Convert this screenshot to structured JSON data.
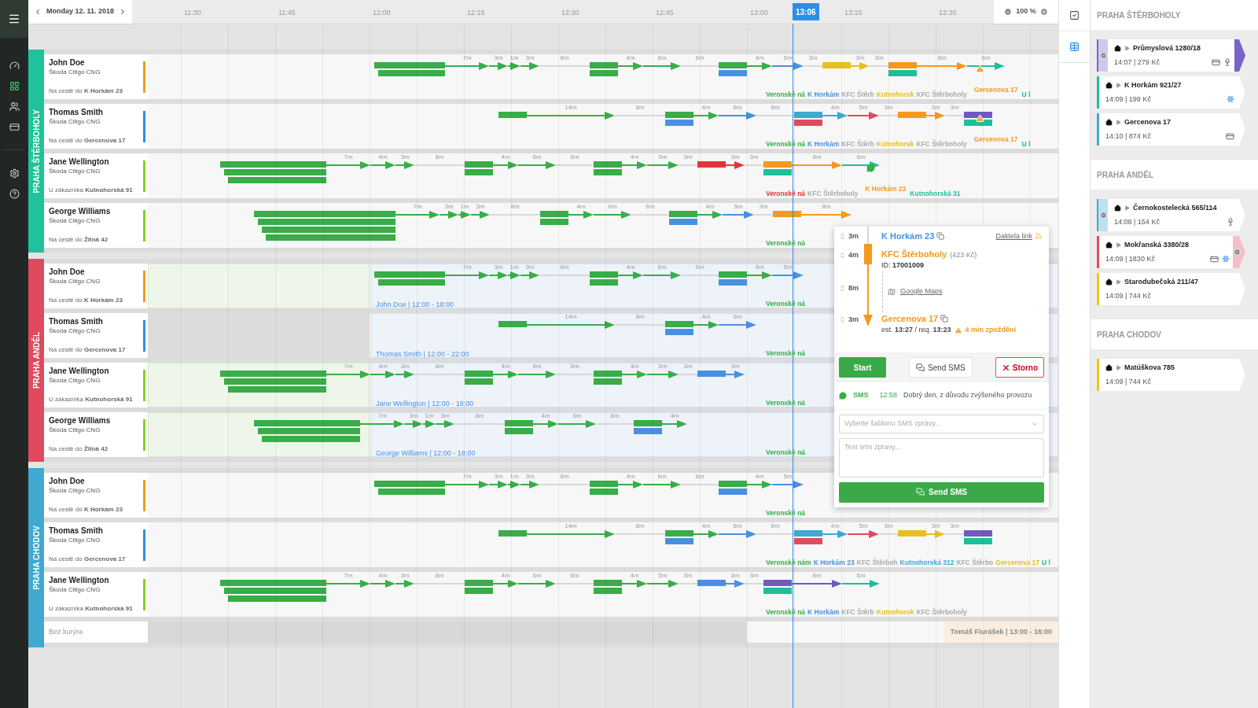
{
  "nav": {
    "items": [
      {
        "kind": "dashboard",
        "selected": false
      },
      {
        "kind": "planner",
        "selected": true
      },
      {
        "kind": "couriers",
        "selected": false
      },
      {
        "kind": "payments",
        "selected": false
      },
      {
        "kind": "settings",
        "selected": false
      },
      {
        "kind": "help",
        "selected": false
      }
    ]
  },
  "date_nav": {
    "label": "Monday 12. 11. 2018"
  },
  "timeline": {
    "ticks": [
      "11:30",
      "11:45",
      "12:00",
      "12:15",
      "12:30",
      "12:45",
      "13:00",
      "13:15",
      "13:30"
    ],
    "now": "13:06"
  },
  "zoom": {
    "label": "100 %"
  },
  "groups": [
    {
      "name": "PRAHA ŠTĚRBOHOLY",
      "color": "#1fc29a",
      "couriers": [
        {
          "name": "John Doe",
          "vehicle": "Škoda Citigo CNG",
          "status": "Na cestě do **K Horkám 23**",
          "color": "#f39a1e",
          "track": [
            {
              "kind": "long",
              "parts": [
                {
                  "color": "#38ad48"
                },
                {
                  "color": "#38ad48"
                }
              ]
            },
            {
              "kind": "drive",
              "label": "7m",
              "color": "#38ad48"
            },
            {
              "kind": "drive",
              "label": "3m",
              "color": "#38ad48"
            },
            {
              "kind": "drive",
              "label": "1m",
              "color": "#38ad48"
            },
            {
              "kind": "drive",
              "label": "3m",
              "color": "#38ad48"
            },
            {
              "kind": "wait",
              "label": "8m"
            },
            {
              "kind": "block",
              "parts": [
                {
                  "color": "#38ad48"
                },
                {
                  "color": "#38ad48"
                }
              ]
            },
            {
              "kind": "drive",
              "label": "4m",
              "color": "#38ad48"
            },
            {
              "kind": "drive",
              "label": "6m",
              "color": "#38ad48"
            },
            {
              "kind": "wait",
              "label": "6m"
            },
            {
              "kind": "block",
              "parts": [
                {
                  "color": "#38ad48"
                },
                {
                  "color": "#4a90e2"
                }
              ]
            },
            {
              "kind": "drive",
              "label": "4m",
              "color": "#38ad48"
            },
            {
              "kind": "drive",
              "label": "5m",
              "color": "#4a90e2"
            },
            {
              "kind": "wait",
              "label": "3m"
            },
            {
              "kind": "block",
              "parts": [
                {
                  "color": "#e8c01e"
                }
              ]
            },
            {
              "kind": "drive",
              "label": "3m",
              "color": "#e8c01e"
            },
            {
              "kind": "wait",
              "label": "3m"
            },
            {
              "kind": "block",
              "parts": [
                {
                  "color": "#f39a1e"
                },
                {
                  "color": "#1dbf97"
                }
              ]
            },
            {
              "kind": "drive",
              "label": "8m",
              "color": "#f39a1e"
            },
            {
              "kind": "drive",
              "label": "6m",
              "color": "#1dbf97"
            }
          ],
          "stops": [
            {
              "kind": "stop",
              "text": "Veronské ná",
              "color": "#38ad48"
            },
            {
              "kind": "stop",
              "text": "K Horkám",
              "color": "#4a90e2"
            },
            {
              "kind": "stop",
              "text": "KFC Štěrb",
              "color": "#aaaaaa"
            },
            {
              "kind": "stop",
              "text": "Kutnohorsk",
              "color": "#e8c01e"
            },
            {
              "kind": "stop",
              "text": "KFC Štěrboholy",
              "color": "#aaaaaa"
            },
            {
              "kind": "alert",
              "text": "Gercenova 17",
              "color": "#f39a1e"
            },
            {
              "kind": "stop",
              "text": "U l",
              "color": "#1dbf97"
            }
          ]
        },
        {
          "name": "Thomas Smith",
          "vehicle": "Škoda Citigo CNG",
          "status": "Na cestě do **Gercenova 17**",
          "color": "#2d8ee6",
          "track": [
            {
              "kind": "block",
              "parts": [
                {
                  "color": "#38ad48"
                }
              ]
            },
            {
              "kind": "drive",
              "label": "14m",
              "color": "#38ad48"
            },
            {
              "kind": "wait",
              "label": "8m"
            },
            {
              "kind": "block",
              "parts": [
                {
                  "color": "#38ad48"
                },
                {
                  "color": "#4a90e2"
                }
              ]
            },
            {
              "kind": "drive",
              "label": "4m",
              "color": "#38ad48"
            },
            {
              "kind": "drive",
              "label": "6m",
              "color": "#4a90e2"
            },
            {
              "kind": "wait",
              "label": "6m"
            },
            {
              "kind": "block",
              "parts": [
                {
                  "color": "#3fa9d0"
                },
                {
                  "color": "#e04a5f"
                }
              ]
            },
            {
              "kind": "drive",
              "label": "4m",
              "color": "#3fa9d0"
            },
            {
              "kind": "drive",
              "label": "5m",
              "color": "#e04a5f"
            },
            {
              "kind": "wait",
              "label": "3m"
            },
            {
              "kind": "block",
              "parts": [
                {
                  "color": "#f39a1e"
                }
              ]
            },
            {
              "kind": "drive",
              "label": "3m",
              "color": "#f39a1e"
            },
            {
              "kind": "wait",
              "label": "3m"
            },
            {
              "kind": "block",
              "parts": [
                {
                  "color": "#6e5bc0"
                },
                {
                  "color": "#1dbf97"
                }
              ]
            }
          ],
          "stops": [
            {
              "kind": "stop",
              "text": "Veronské ná",
              "color": "#38ad48"
            },
            {
              "kind": "stop",
              "text": "K Horkám",
              "color": "#4a90e2"
            },
            {
              "kind": "stop",
              "text": "KFC Štěrb",
              "color": "#aaaaaa"
            },
            {
              "kind": "stop",
              "text": "Kutnohorsk",
              "color": "#e8c01e"
            },
            {
              "kind": "stop",
              "text": "KFC Štěrboholy",
              "color": "#aaaaaa"
            },
            {
              "kind": "alert",
              "text": "Gercenova 17",
              "color": "#f39a1e"
            },
            {
              "kind": "stop",
              "text": "U l",
              "color": "#1dbf97"
            }
          ]
        },
        {
          "name": "Jane Wellington",
          "vehicle": "Škoda Citigo CNG",
          "status": "U zákazníka **Kutnohorská 91**",
          "color": "#7ed321",
          "track": [
            {
              "kind": "long",
              "parts": [
                {
                  "color": "#38ad48"
                },
                {
                  "color": "#38ad48"
                },
                {
                  "color": "#38ad48"
                }
              ]
            },
            {
              "kind": "drive",
              "label": "7m",
              "color": "#38ad48"
            },
            {
              "kind": "drive",
              "label": "4m",
              "color": "#38ad48"
            },
            {
              "kind": "drive",
              "label": "3m",
              "color": "#38ad48"
            },
            {
              "kind": "wait",
              "label": "8m"
            },
            {
              "kind": "block",
              "parts": [
                {
                  "color": "#38ad48"
                },
                {
                  "color": "#38ad48"
                }
              ]
            },
            {
              "kind": "drive",
              "label": "4m",
              "color": "#38ad48"
            },
            {
              "kind": "drive",
              "label": "6m",
              "color": "#38ad48"
            },
            {
              "kind": "wait",
              "label": "6m"
            },
            {
              "kind": "block",
              "parts": [
                {
                  "color": "#38ad48"
                },
                {
                  "color": "#38ad48"
                }
              ]
            },
            {
              "kind": "drive",
              "label": "4m",
              "color": "#38ad48"
            },
            {
              "kind": "drive",
              "label": "5m",
              "color": "#38ad48"
            },
            {
              "kind": "wait",
              "label": "3m"
            },
            {
              "kind": "block",
              "parts": [
                {
                  "color": "#e5333b"
                }
              ]
            },
            {
              "kind": "drive",
              "label": "3m",
              "color": "#e5333b"
            },
            {
              "kind": "wait",
              "label": "3m"
            },
            {
              "kind": "block",
              "parts": [
                {
                  "color": "#f39a1e"
                },
                {
                  "color": "#1dbf97"
                }
              ]
            },
            {
              "kind": "drive",
              "label": "8m",
              "color": "#f39a1e"
            },
            {
              "kind": "drive",
              "label": "6m",
              "color": "#1dbf97"
            }
          ],
          "stops": [
            {
              "kind": "stop",
              "text": "Veronské ná",
              "color": "#e5333b"
            },
            {
              "kind": "stop",
              "text": "KFC Štěrboholy",
              "color": "#aaaaaa"
            },
            {
              "kind": "chat",
              "text": "K Horkám 23",
              "color": "#f39a1e"
            },
            {
              "kind": "stop",
              "text": "Kutnohorská 31",
              "color": "#1dbf97"
            }
          ]
        },
        {
          "name": "George Williams",
          "vehicle": "Škoda Citigo CNG",
          "status": "Na cestě do **Žitná 42**",
          "color": "#7ed321",
          "track": [
            {
              "kind": "long",
              "parts": [
                {
                  "color": "#38ad48"
                },
                {
                  "color": "#38ad48"
                },
                {
                  "color": "#38ad48"
                },
                {
                  "color": "#38ad48"
                }
              ]
            },
            {
              "kind": "drive",
              "label": "7m",
              "color": "#38ad48"
            },
            {
              "kind": "drive",
              "label": "3m",
              "color": "#38ad48"
            },
            {
              "kind": "drive",
              "label": "1m",
              "color": "#38ad48"
            },
            {
              "kind": "drive",
              "label": "3m",
              "color": "#38ad48"
            },
            {
              "kind": "wait",
              "label": "8m"
            },
            {
              "kind": "block",
              "parts": [
                {
                  "color": "#38ad48"
                },
                {
                  "color": "#38ad48"
                }
              ]
            },
            {
              "kind": "drive",
              "label": "4m",
              "color": "#38ad48"
            },
            {
              "kind": "drive",
              "label": "6m",
              "color": "#38ad48"
            },
            {
              "kind": "wait",
              "label": "6m"
            },
            {
              "kind": "block",
              "parts": [
                {
                  "color": "#38ad48"
                },
                {
                  "color": "#4a90e2"
                }
              ]
            },
            {
              "kind": "drive",
              "label": "4m",
              "color": "#38ad48"
            },
            {
              "kind": "drive",
              "label": "5m",
              "color": "#4a90e2"
            },
            {
              "kind": "wait",
              "label": "3m"
            },
            {
              "kind": "block",
              "parts": [
                {
                  "color": "#f39a1e"
                }
              ]
            },
            {
              "kind": "drive",
              "label": "8m",
              "color": "#f39a1e"
            }
          ],
          "stops": [
            {
              "kind": "stop",
              "text": "Veronské ná",
              "color": "#38ad48"
            }
          ]
        }
      ]
    },
    {
      "name": "PRAHA ANDĚL",
      "color": "#e04a5f",
      "couriers": [
        {
          "name": "John Doe",
          "vehicle": "Škoda Citigo CNG",
          "status": "Na cestě do **K Horkám 23**",
          "color": "#f39a1e",
          "shift": {
            "label": "John Doe | 12:00 - 18:00",
            "free_before": true
          },
          "track": [
            {
              "kind": "long",
              "parts": [
                {
                  "color": "#38ad48"
                },
                {
                  "color": "#38ad48"
                }
              ]
            },
            {
              "kind": "drive",
              "label": "7m",
              "color": "#38ad48"
            },
            {
              "kind": "drive",
              "label": "3m",
              "color": "#38ad48"
            },
            {
              "kind": "drive",
              "label": "1m",
              "color": "#38ad48"
            },
            {
              "kind": "drive",
              "label": "3m",
              "color": "#38ad48"
            },
            {
              "kind": "wait",
              "label": "8m"
            },
            {
              "kind": "block",
              "parts": [
                {
                  "color": "#38ad48"
                },
                {
                  "color": "#38ad48"
                }
              ]
            },
            {
              "kind": "drive",
              "label": "4m",
              "color": "#38ad48"
            },
            {
              "kind": "drive",
              "label": "6m",
              "color": "#38ad48"
            },
            {
              "kind": "wait",
              "label": "6m"
            },
            {
              "kind": "block",
              "parts": [
                {
                  "color": "#38ad48"
                },
                {
                  "color": "#4a90e2"
                }
              ]
            },
            {
              "kind": "drive",
              "label": "4m",
              "color": "#38ad48"
            },
            {
              "kind": "drive",
              "label": "5m",
              "color": "#4a90e2"
            }
          ],
          "stops": [
            {
              "kind": "stop",
              "text": "Veronské ná",
              "color": "#38ad48"
            }
          ]
        },
        {
          "name": "Thomas Smith",
          "vehicle": "Škoda Citigo CNG",
          "status": "Na cestě do **Gercenova 17**",
          "color": "#2d8ee6",
          "shift": {
            "label": "Thomas Smith | 12:00 - 22:00",
            "free_before": false
          },
          "track": [
            {
              "kind": "block",
              "parts": [
                {
                  "color": "#38ad48"
                }
              ]
            },
            {
              "kind": "drive",
              "label": "14m",
              "color": "#38ad48"
            },
            {
              "kind": "wait",
              "label": "8m"
            },
            {
              "kind": "block",
              "parts": [
                {
                  "color": "#38ad48"
                },
                {
                  "color": "#4a90e2"
                }
              ]
            },
            {
              "kind": "drive",
              "label": "4m",
              "color": "#38ad48"
            },
            {
              "kind": "drive",
              "label": "6m",
              "color": "#4a90e2"
            }
          ],
          "stops": [
            {
              "kind": "stop",
              "text": "Veronské ná",
              "color": "#38ad48"
            }
          ]
        },
        {
          "name": "Jane Wellington",
          "vehicle": "Škoda Citigo CNG",
          "status": "U zákazníka **Kutnohorská 91**",
          "color": "#7ed321",
          "shift": {
            "label": "Jane Wellington | 12:00 - 18:00",
            "free_before": true
          },
          "track": [
            {
              "kind": "long",
              "parts": [
                {
                  "color": "#38ad48"
                },
                {
                  "color": "#38ad48"
                },
                {
                  "color": "#38ad48"
                }
              ]
            },
            {
              "kind": "drive",
              "label": "7m",
              "color": "#38ad48"
            },
            {
              "kind": "drive",
              "label": "4m",
              "color": "#38ad48"
            },
            {
              "kind": "drive",
              "label": "3m",
              "color": "#38ad48"
            },
            {
              "kind": "wait",
              "label": "8m"
            },
            {
              "kind": "block",
              "parts": [
                {
                  "color": "#38ad48"
                },
                {
                  "color": "#38ad48"
                }
              ]
            },
            {
              "kind": "drive",
              "label": "4m",
              "color": "#38ad48"
            },
            {
              "kind": "drive",
              "label": "6m",
              "color": "#38ad48"
            },
            {
              "kind": "wait",
              "label": "6m"
            },
            {
              "kind": "block",
              "parts": [
                {
                  "color": "#38ad48"
                },
                {
                  "color": "#38ad48"
                }
              ]
            },
            {
              "kind": "drive",
              "label": "4m",
              "color": "#38ad48"
            },
            {
              "kind": "drive",
              "label": "5m",
              "color": "#38ad48"
            },
            {
              "kind": "wait",
              "label": "3m"
            },
            {
              "kind": "block",
              "parts": [
                {
                  "color": "#4a90e2"
                }
              ]
            },
            {
              "kind": "drive",
              "label": "3m",
              "color": "#4a90e2"
            }
          ],
          "stops": [
            {
              "kind": "stop",
              "text": "Veronské ná",
              "color": "#38ad48"
            }
          ]
        },
        {
          "name": "George Williams",
          "vehicle": "Škoda Citigo CNG",
          "status": "Na cestě do **Žitná 42**",
          "color": "#7ed321",
          "shift": {
            "label": "George Williams | 12:00 - 18:00",
            "free_before": true
          },
          "track": [
            {
              "kind": "long",
              "parts": [
                {
                  "color": "#38ad48"
                },
                {
                  "color": "#38ad48"
                },
                {
                  "color": "#38ad48"
                }
              ]
            },
            {
              "kind": "drive",
              "label": "7m",
              "color": "#38ad48"
            },
            {
              "kind": "drive",
              "label": "3m",
              "color": "#38ad48"
            },
            {
              "kind": "drive",
              "label": "1m",
              "color": "#38ad48"
            },
            {
              "kind": "drive",
              "label": "3m",
              "color": "#38ad48"
            },
            {
              "kind": "wait",
              "label": "8m"
            },
            {
              "kind": "block",
              "parts": [
                {
                  "color": "#38ad48"
                },
                {
                  "color": "#38ad48"
                }
              ]
            },
            {
              "kind": "drive",
              "label": "4m",
              "color": "#38ad48"
            },
            {
              "kind": "drive",
              "label": "6m",
              "color": "#38ad48"
            },
            {
              "kind": "wait",
              "label": "6m"
            },
            {
              "kind": "block",
              "parts": [
                {
                  "color": "#38ad48"
                },
                {
                  "color": "#4a90e2"
                }
              ]
            },
            {
              "kind": "drive",
              "label": "4m",
              "color": "#38ad48"
            }
          ],
          "stops": [
            {
              "kind": "stop",
              "text": "Veronské ná",
              "color": "#38ad48"
            }
          ]
        }
      ]
    },
    {
      "name": "PRAHA CHODOV",
      "color": "#3fa9d0",
      "couriers": [
        {
          "name": "John Doe",
          "vehicle": "Škoda Citigo CNG",
          "status": "Na cestě do **K Horkám 23**",
          "color": "#f39a1e",
          "track": [
            {
              "kind": "long",
              "parts": [
                {
                  "color": "#38ad48"
                },
                {
                  "color": "#38ad48"
                }
              ]
            },
            {
              "kind": "drive",
              "label": "7m",
              "color": "#38ad48"
            },
            {
              "kind": "drive",
              "label": "3m",
              "color": "#38ad48"
            },
            {
              "kind": "drive",
              "label": "1m",
              "color": "#38ad48"
            },
            {
              "kind": "drive",
              "label": "3m",
              "color": "#38ad48"
            },
            {
              "kind": "wait",
              "label": "8m"
            },
            {
              "kind": "block",
              "parts": [
                {
                  "color": "#38ad48"
                },
                {
                  "color": "#38ad48"
                }
              ]
            },
            {
              "kind": "drive",
              "label": "4m",
              "color": "#38ad48"
            },
            {
              "kind": "drive",
              "label": "6m",
              "color": "#38ad48"
            },
            {
              "kind": "wait",
              "label": "6m"
            },
            {
              "kind": "block",
              "parts": [
                {
                  "color": "#38ad48"
                },
                {
                  "color": "#4a90e2"
                }
              ]
            },
            {
              "kind": "drive",
              "label": "4m",
              "color": "#38ad48"
            },
            {
              "kind": "drive",
              "label": "5m",
              "color": "#4a90e2"
            }
          ],
          "stops": [
            {
              "kind": "stop",
              "text": "Veronské ná",
              "color": "#38ad48"
            }
          ]
        },
        {
          "name": "Thomas Smith",
          "vehicle": "Škoda Citigo CNG",
          "status": "Na cestě do **Gercenova 17**",
          "color": "#2d8ee6",
          "track": [
            {
              "kind": "block",
              "parts": [
                {
                  "color": "#38ad48"
                }
              ]
            },
            {
              "kind": "drive",
              "label": "14m",
              "color": "#38ad48"
            },
            {
              "kind": "wait",
              "label": "8m"
            },
            {
              "kind": "block",
              "parts": [
                {
                  "color": "#38ad48"
                },
                {
                  "color": "#4a90e2"
                }
              ]
            },
            {
              "kind": "drive",
              "label": "4m",
              "color": "#38ad48"
            },
            {
              "kind": "drive",
              "label": "6m",
              "color": "#4a90e2"
            },
            {
              "kind": "wait",
              "label": "6m"
            },
            {
              "kind": "block",
              "parts": [
                {
                  "color": "#3fa9d0"
                },
                {
                  "color": "#e04a5f"
                }
              ]
            },
            {
              "kind": "drive",
              "label": "4m",
              "color": "#3fa9d0"
            },
            {
              "kind": "drive",
              "label": "5m",
              "color": "#e04a5f"
            },
            {
              "kind": "wait",
              "label": "3m"
            },
            {
              "kind": "block",
              "parts": [
                {
                  "color": "#e8c01e"
                }
              ]
            },
            {
              "kind": "drive",
              "label": "3m",
              "color": "#e8c01e"
            },
            {
              "kind": "wait",
              "label": "3m"
            },
            {
              "kind": "block",
              "parts": [
                {
                  "color": "#6e5bc0"
                },
                {
                  "color": "#1dbf97"
                }
              ]
            }
          ],
          "stops": [
            {
              "kind": "stop",
              "text": "Veronské nám",
              "color": "#38ad48"
            },
            {
              "kind": "stop",
              "text": "K Horkám 23",
              "color": "#4a90e2"
            },
            {
              "kind": "stop",
              "text": "KFC Štěrboh",
              "color": "#aaaaaa"
            },
            {
              "kind": "stop",
              "text": "Kutnohorská 312",
              "color": "#3fa9d0"
            },
            {
              "kind": "stop",
              "text": "KFC Štěrbo",
              "color": "#aaaaaa"
            },
            {
              "kind": "stop",
              "text": "Gercenova 17",
              "color": "#e8c01e"
            },
            {
              "kind": "stop",
              "text": "U l",
              "color": "#1dbf97"
            }
          ]
        },
        {
          "name": "Jane Wellington",
          "vehicle": "Škoda Citigo CNG",
          "status": "U zákazníka **Kutnohorská 91**",
          "color": "#7ed321",
          "track": [
            {
              "kind": "long",
              "parts": [
                {
                  "color": "#38ad48"
                },
                {
                  "color": "#38ad48"
                },
                {
                  "color": "#38ad48"
                }
              ]
            },
            {
              "kind": "drive",
              "label": "7m",
              "color": "#38ad48"
            },
            {
              "kind": "drive",
              "label": "4m",
              "color": "#38ad48"
            },
            {
              "kind": "drive",
              "label": "3m",
              "color": "#38ad48"
            },
            {
              "kind": "wait",
              "label": "8m"
            },
            {
              "kind": "block",
              "parts": [
                {
                  "color": "#38ad48"
                },
                {
                  "color": "#38ad48"
                }
              ]
            },
            {
              "kind": "drive",
              "label": "4m",
              "color": "#38ad48"
            },
            {
              "kind": "drive",
              "label": "6m",
              "color": "#38ad48"
            },
            {
              "kind": "wait",
              "label": "6m"
            },
            {
              "kind": "block",
              "parts": [
                {
                  "color": "#38ad48"
                },
                {
                  "color": "#38ad48"
                }
              ]
            },
            {
              "kind": "drive",
              "label": "4m",
              "color": "#38ad48"
            },
            {
              "kind": "drive",
              "label": "5m",
              "color": "#38ad48"
            },
            {
              "kind": "wait",
              "label": "3m"
            },
            {
              "kind": "block",
              "parts": [
                {
                  "color": "#4a90e2"
                }
              ]
            },
            {
              "kind": "drive",
              "label": "3m",
              "color": "#4a90e2"
            },
            {
              "kind": "wait",
              "label": "3m"
            },
            {
              "kind": "block",
              "parts": [
                {
                  "color": "#6e5bc0"
                },
                {
                  "color": "#1dbf97"
                }
              ]
            },
            {
              "kind": "drive",
              "label": "8m",
              "color": "#6e5bc0"
            },
            {
              "kind": "drive",
              "label": "6m",
              "color": "#1dbf97"
            }
          ],
          "stops": [
            {
              "kind": "stop",
              "text": "Veronské ná",
              "color": "#38ad48"
            },
            {
              "kind": "stop",
              "text": "K Horkám",
              "color": "#4a90e2"
            },
            {
              "kind": "stop",
              "text": "KFC Štěrb",
              "color": "#aaaaaa"
            },
            {
              "kind": "stop",
              "text": "Kutnohorsk",
              "color": "#e8c01e"
            },
            {
              "kind": "stop",
              "text": "KFC Štěrboholy",
              "color": "#aaaaaa"
            }
          ]
        }
      ],
      "unassigned": {
        "label": "Bez kurýra",
        "shift": "Tomáš Fiurášek | 13:00 - 16:00"
      }
    }
  ],
  "popup": {
    "durations": [
      "3m",
      "4m",
      "8m",
      "3m"
    ],
    "from": "K Horkám 23",
    "link": "Daktela link",
    "pickup": {
      "name": "KFC Štěrboholy",
      "price": "(423 Kč)",
      "id": "ID: **17001009**"
    },
    "maps": "Google Maps",
    "drop": {
      "name": "Gercenova 17",
      "times": "est. **13:27** / req. **13:23**",
      "delay": "4 min zpoždění"
    },
    "buttons": {
      "start": "Start",
      "sms": "Send SMS",
      "cancel": "Storno"
    },
    "sms": {
      "label": "SMS",
      "time": "12:58",
      "text": "Dobrý den, z důvodu zvýšeného provozu"
    },
    "template": {
      "placeholder": "Vyberte šablonu SMS zprávy..."
    },
    "message": {
      "placeholder": "Text sms zpravy..."
    },
    "send": "Send SMS"
  },
  "side_tools": [
    {
      "kind": "checklist",
      "selected": false
    },
    {
      "kind": "table",
      "selected": true
    }
  ],
  "order_groups": [
    {
      "name": "PRAHA ŠTĚRBOHOLY",
      "orders": [
        {
          "address": "Průmyslová 1280/18",
          "meta": "14:07 | 279 Kč",
          "color": "#7a62c9",
          "confirmed": true,
          "tail": true,
          "tail_confirmed": false,
          "card": true,
          "fragile": true,
          "cold": false
        },
        {
          "address": "K Horkám 921/27",
          "meta": "14:09 | 199 Kč",
          "color": "#1dbf97",
          "confirmed": false,
          "tail": false,
          "tail_confirmed": false,
          "card": false,
          "fragile": false,
          "cold": true
        },
        {
          "address": "Gercenova 17",
          "meta": "14:10 | 874 Kč",
          "color": "#3fa9d0",
          "confirmed": false,
          "tail": false,
          "tail_confirmed": false,
          "card": true,
          "fragile": false,
          "cold": false
        }
      ]
    },
    {
      "name": "PRAHA ANDĚL",
      "orders": [
        {
          "address": "Černokostelecká 565/114",
          "meta": "14:08 | 154 Kč",
          "color": "#3fa9d0",
          "confirmed": true,
          "tail": false,
          "tail_confirmed": false,
          "card": false,
          "fragile": true,
          "cold": false
        },
        {
          "address": "Mokřanská 3380/28",
          "meta": "14:09 | 1830 Kč",
          "color": "#e04a5f",
          "confirmed": false,
          "tail": false,
          "tail_confirmed": true,
          "card": true,
          "fragile": false,
          "cold": true
        },
        {
          "address": "Starodubečská 211/47",
          "meta": "14:09 | 744 Kč",
          "color": "#f0c419",
          "confirmed": false,
          "tail": false,
          "tail_confirmed": false,
          "card": false,
          "fragile": false,
          "cold": false
        }
      ]
    },
    {
      "name": "PRAHA CHODOV",
      "orders": [
        {
          "address": "Matúškova 785",
          "meta": "14:09 | 744 Kč",
          "color": "#f0c419",
          "confirmed": false,
          "tail": false,
          "tail_confirmed": false,
          "card": false,
          "fragile": false,
          "cold": false
        }
      ]
    }
  ]
}
